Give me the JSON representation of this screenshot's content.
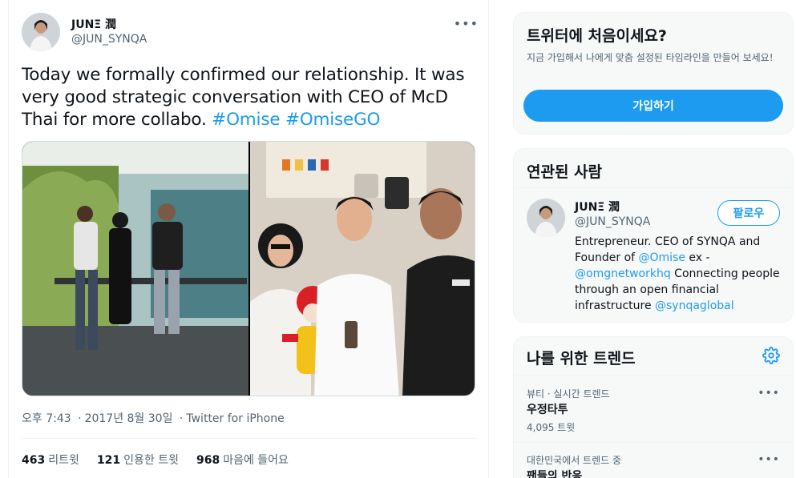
{
  "tweet": {
    "author_name": "JUNΞ 潤",
    "author_handle": "@JUN_SYNQA",
    "more_icon": "more-icon",
    "text_plain": "Today we formally confirmed our relationship. It was very good strategic conversation with CEO of McD Thai for more collabo. ",
    "hashtag_1": "#Omise",
    "hashtag_2": "#OmiseGO",
    "time": "오후 7:43",
    "date": "2017년 8월 30일",
    "separator": "·",
    "source": "Twitter for iPhone",
    "stats": [
      {
        "count": "463",
        "label": "리트윗"
      },
      {
        "count": "121",
        "label": "인용한 트윗"
      },
      {
        "count": "968",
        "label": "마음에 들어요"
      }
    ],
    "accent_color": "#1d9bf0"
  },
  "signup": {
    "title": "트위터에 처음이세요?",
    "description": "지금 가입해서 나에게 맞춤 설정된 타임라인을 만들어 보세요!",
    "button_label": "가입하기"
  },
  "related": {
    "title": "연관된 사람",
    "name": "JUNΞ 潤",
    "handle": "@JUN_SYNQA",
    "follow_label": "팔로우",
    "bio_1": "Entrepreneur. CEO of SYNQA and Founder of ",
    "mention_1": "@Omise",
    "bio_2": " ex - ",
    "mention_2": "@omgnetworkhq",
    "bio_3": " Connecting people through an open financial infrastructure ",
    "mention_3": "@synqaglobal"
  },
  "trends": {
    "title": "나를 위한 트렌드",
    "settings_icon": "gear-icon",
    "items": [
      {
        "context": "뷰티 · 실시간 트렌드",
        "name": "우정타투",
        "count": "4,095 트윗"
      },
      {
        "context": "대한민국에서 트렌드 중",
        "name": "팬들의 반응",
        "count": ""
      }
    ]
  }
}
